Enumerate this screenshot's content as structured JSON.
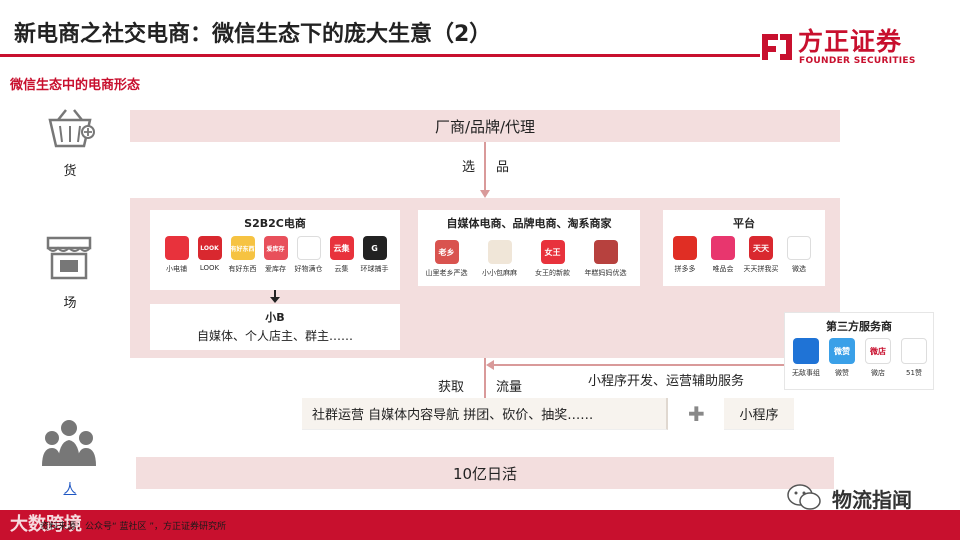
{
  "header": {
    "title": "新电商之社交电商：微信生态下的庞大生意（2）",
    "logo_cn": "方正证券",
    "logo_en": "FOUNDER SECURITIES"
  },
  "subtitle": "微信生态中的电商形态",
  "side": {
    "goods": "货",
    "field": "场",
    "people": "人"
  },
  "bands": {
    "top": "厂商/品牌/代理",
    "bottom": "10亿日活"
  },
  "flow": {
    "select_a": "选",
    "select_b": "品",
    "acquire": "获取",
    "traffic": "流量",
    "service": "小程序开发、运营辅助服务",
    "ops": "社群运营 自媒体内容导航 拼团、砍价、抽奖……",
    "plus": "✚",
    "miniprogram": "小程序"
  },
  "s2b2c": {
    "title": "S2B2C电商",
    "apps": [
      {
        "label": "小电铺",
        "short": "",
        "color": "#e8323c"
      },
      {
        "label": "LOOK",
        "short": "LOOK",
        "color": "#d9282f"
      },
      {
        "label": "有好东西",
        "short": "有好东西",
        "color": "#f6c342"
      },
      {
        "label": "爱库存",
        "short": "爱库存",
        "color": "#e8505b"
      },
      {
        "label": "好物满仓",
        "short": "",
        "color": "#ffffff"
      },
      {
        "label": "云集",
        "short": "云集",
        "color": "#e8323c"
      },
      {
        "label": "环球捕手",
        "short": "G",
        "color": "#222222"
      }
    ],
    "small_b_title": "小B",
    "small_b_desc": "自媒体、个人店主、群主……"
  },
  "media": {
    "title": "自媒体电商、品牌电商、淘系商家",
    "apps": [
      {
        "label": "山里老乡严选",
        "short": "老乡",
        "color": "#d9534f"
      },
      {
        "label": "小小包麻麻",
        "short": "",
        "color": "#f0e6d8"
      },
      {
        "label": "女王的新款",
        "short": "女王",
        "color": "#e8323c"
      },
      {
        "label": "年糕妈妈优选",
        "short": "",
        "color": "#b7413e"
      }
    ]
  },
  "platform": {
    "title": "平台",
    "apps": [
      {
        "label": "拼多多",
        "short": "",
        "color": "#e02e24"
      },
      {
        "label": "唯品会",
        "short": "",
        "color": "#e8366e"
      },
      {
        "label": "天天拼我买",
        "short": "天天",
        "color": "#d9282f"
      },
      {
        "label": "微选",
        "short": "",
        "color": "#ffffff"
      }
    ]
  },
  "third_party": {
    "title": "第三方服务商",
    "apps": [
      {
        "label": "无敌事组",
        "short": "",
        "color": "#1f73d6"
      },
      {
        "label": "微赞",
        "short": "微赞",
        "color": "#3aa0e8"
      },
      {
        "label": "微店",
        "short": "微店",
        "color": "#ffffff"
      },
      {
        "label": "51赞",
        "short": "",
        "color": "#ffffff"
      }
    ]
  },
  "footer": {
    "source": "资料来源：公众号“ 蓝社区 ”，方正证券研究所",
    "watermark": "大数跨境",
    "brand": "物流指闻"
  },
  "colors": {
    "brand_red": "#c8102e",
    "band_pink": "#f3dede",
    "arrow_pink": "#d99a9a"
  }
}
